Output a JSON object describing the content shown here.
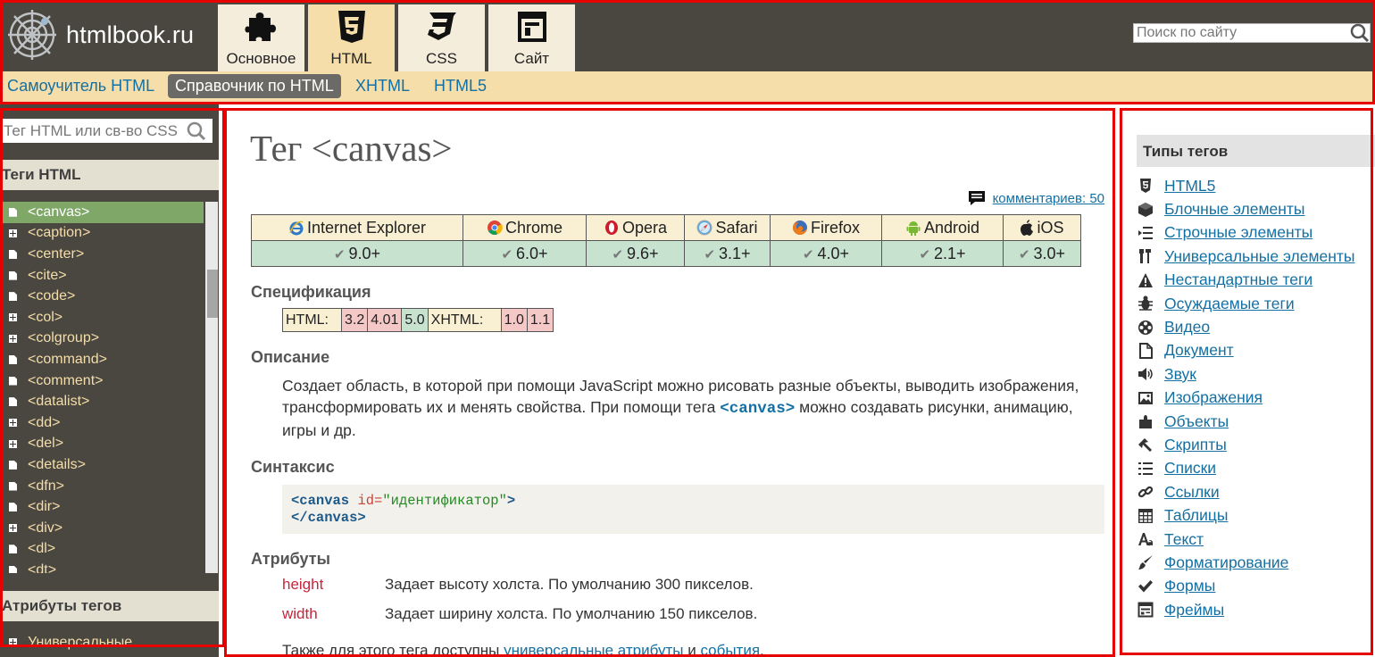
{
  "header": {
    "logo_text": "htmlbook.ru",
    "tabs": [
      {
        "label": "Основное",
        "icon": "puzzle-icon"
      },
      {
        "label": "HTML",
        "icon": "html5-icon"
      },
      {
        "label": "CSS",
        "icon": "css3-icon"
      },
      {
        "label": "Сайт",
        "icon": "site-layout-icon"
      }
    ],
    "active_tab": "HTML",
    "search_placeholder": "Поиск по сайту"
  },
  "subnav": {
    "items": [
      "Самоучитель HTML",
      "Справочник по HTML",
      "XHTML",
      "HTML5"
    ],
    "current": "Справочник по HTML"
  },
  "left_sidebar": {
    "search_placeholder": "Тег HTML или св-во CSS",
    "tags_heading": "Теги HTML",
    "tags": [
      {
        "label": "<canvas>",
        "icon": "doc-icon",
        "selected": true
      },
      {
        "label": "<caption>",
        "icon": "plus-icon"
      },
      {
        "label": "<center>",
        "icon": "doc-icon"
      },
      {
        "label": "<cite>",
        "icon": "doc-icon"
      },
      {
        "label": "<code>",
        "icon": "doc-icon"
      },
      {
        "label": "<col>",
        "icon": "plus-icon"
      },
      {
        "label": "<colgroup>",
        "icon": "plus-icon"
      },
      {
        "label": "<command>",
        "icon": "doc-icon"
      },
      {
        "label": "<comment>",
        "icon": "doc-icon"
      },
      {
        "label": "<datalist>",
        "icon": "doc-icon"
      },
      {
        "label": "<dd>",
        "icon": "plus-icon"
      },
      {
        "label": "<del>",
        "icon": "plus-icon"
      },
      {
        "label": "<details>",
        "icon": "doc-icon"
      },
      {
        "label": "<dfn>",
        "icon": "doc-icon"
      },
      {
        "label": "<dir>",
        "icon": "doc-icon"
      },
      {
        "label": "<div>",
        "icon": "plus-icon"
      },
      {
        "label": "<dl>",
        "icon": "doc-icon"
      },
      {
        "label": "<dt>",
        "icon": "doc-icon"
      }
    ],
    "attrs_heading": "Атрибуты тегов",
    "attrs_first": "Универсальные"
  },
  "main": {
    "title": "Тег <canvas>",
    "comments_link": "комментариев: 50",
    "browsers": [
      {
        "name": "Internet Explorer",
        "version": "9.0+",
        "icon": "ie-icon"
      },
      {
        "name": "Chrome",
        "version": "6.0+",
        "icon": "chrome-icon"
      },
      {
        "name": "Opera",
        "version": "9.6+",
        "icon": "opera-icon"
      },
      {
        "name": "Safari",
        "version": "3.1+",
        "icon": "safari-icon"
      },
      {
        "name": "Firefox",
        "version": "4.0+",
        "icon": "firefox-icon"
      },
      {
        "name": "Android",
        "version": "2.1+",
        "icon": "android-icon"
      },
      {
        "name": "iOS",
        "version": "3.0+",
        "icon": "apple-icon"
      }
    ],
    "spec_heading": "Спецификация",
    "spec": {
      "html_label": "HTML:",
      "html_versions": [
        "3.2",
        "4.01",
        "5.0"
      ],
      "xhtml_label": "XHTML:",
      "xhtml_versions": [
        "1.0",
        "1.1"
      ]
    },
    "desc_heading": "Описание",
    "desc_before": "Создает область, в которой при помощи JavaScript можно рисовать разные объекты, выводить изображения, трансформировать их и менять свойства. При помощи тега ",
    "desc_code": "<canvas>",
    "desc_after": " можно создавать рисунки, анимацию, игры и др.",
    "syntax_heading": "Синтаксис",
    "syntax": {
      "open_tag": "<canvas",
      "attr": "id=",
      "value": "\"идентификатор\"",
      "open_end": ">",
      "close_tag": "</canvas>"
    },
    "attrs_heading": "Атрибуты",
    "attributes": [
      {
        "name": "height",
        "desc": "Задает высоту холста. По умолчанию 300 пикселов."
      },
      {
        "name": "width",
        "desc": "Задает ширину холста. По умолчанию 150 пикселов."
      }
    ],
    "also_text": "Также для этого тега доступны ",
    "also_link1": "универсальные атрибуты",
    "also_and": " и ",
    "also_link2": "события",
    "also_end": "."
  },
  "right_sidebar": {
    "heading": "Типы тегов",
    "items": [
      {
        "label": "HTML5",
        "icon": "html5-icon"
      },
      {
        "label": "Блочные элементы",
        "icon": "block-icon"
      },
      {
        "label": "Строчные элементы",
        "icon": "inline-icon"
      },
      {
        "label": "Универсальные элементы",
        "icon": "tools-icon"
      },
      {
        "label": "Нестандартные теги",
        "icon": "warning-icon"
      },
      {
        "label": "Осуждаемые теги",
        "icon": "bug-icon"
      },
      {
        "label": "Видео",
        "icon": "film-icon"
      },
      {
        "label": "Документ",
        "icon": "document-icon"
      },
      {
        "label": "Звук",
        "icon": "sound-icon"
      },
      {
        "label": "Изображения",
        "icon": "image-icon"
      },
      {
        "label": "Объекты",
        "icon": "plugin-icon"
      },
      {
        "label": "Скрипты",
        "icon": "script-icon"
      },
      {
        "label": "Списки",
        "icon": "list-icon"
      },
      {
        "label": "Ссылки",
        "icon": "link-icon"
      },
      {
        "label": "Таблицы",
        "icon": "table-icon"
      },
      {
        "label": "Текст",
        "icon": "text-icon"
      },
      {
        "label": "Форматирование",
        "icon": "brush-icon"
      },
      {
        "label": "Формы",
        "icon": "check-icon"
      },
      {
        "label": "Фреймы",
        "icon": "frame-icon"
      }
    ]
  }
}
